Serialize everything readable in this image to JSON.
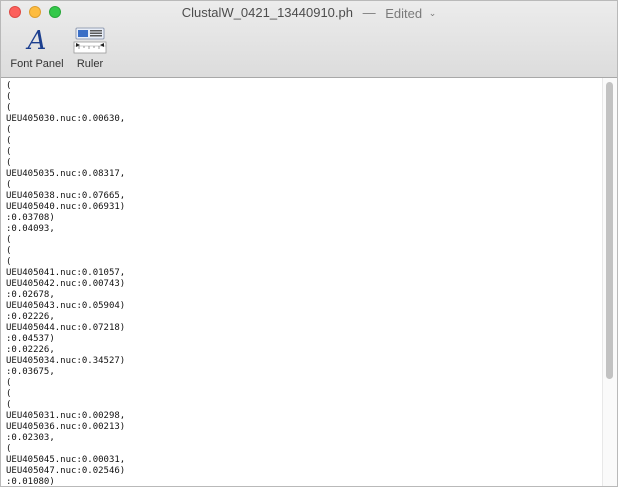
{
  "window": {
    "title": "ClustalW_0421_13440910.ph",
    "separator": "—",
    "status": "Edited",
    "status_chevron": "⌄"
  },
  "toolbar": {
    "font_panel_label": "Font Panel",
    "font_panel_icon": "font-icon",
    "font_glyph": "A",
    "ruler_label": "Ruler",
    "ruler_icon": "ruler-icon"
  },
  "document": {
    "lines": [
      "(",
      "(",
      "(",
      "UEU405030.nuc:0.00630,",
      "(",
      "(",
      "(",
      "(",
      "UEU405035.nuc:0.08317,",
      "(",
      "UEU405038.nuc:0.07665,",
      "UEU405040.nuc:0.06931)",
      ":0.03708)",
      ":0.04093,",
      "(",
      "(",
      "(",
      "UEU405041.nuc:0.01057,",
      "UEU405042.nuc:0.00743)",
      ":0.02678,",
      "UEU405043.nuc:0.05904)",
      ":0.02226,",
      "UEU405044.nuc:0.07218)",
      ":0.04537)",
      ":0.02226,",
      "UEU405034.nuc:0.34527)",
      ":0.03675,",
      "(",
      "(",
      "(",
      "UEU405031.nuc:0.00298,",
      "UEU405036.nuc:0.00213)",
      ":0.02303,",
      "(",
      "UEU405045.nuc:0.00031,",
      "UEU405047.nuc:0.02546)",
      ":0.01080)"
    ]
  },
  "colors": {
    "close": "#fc605c",
    "minimize": "#fdbc40",
    "zoom": "#34c84a",
    "font_icon": "#1c3f8f"
  }
}
